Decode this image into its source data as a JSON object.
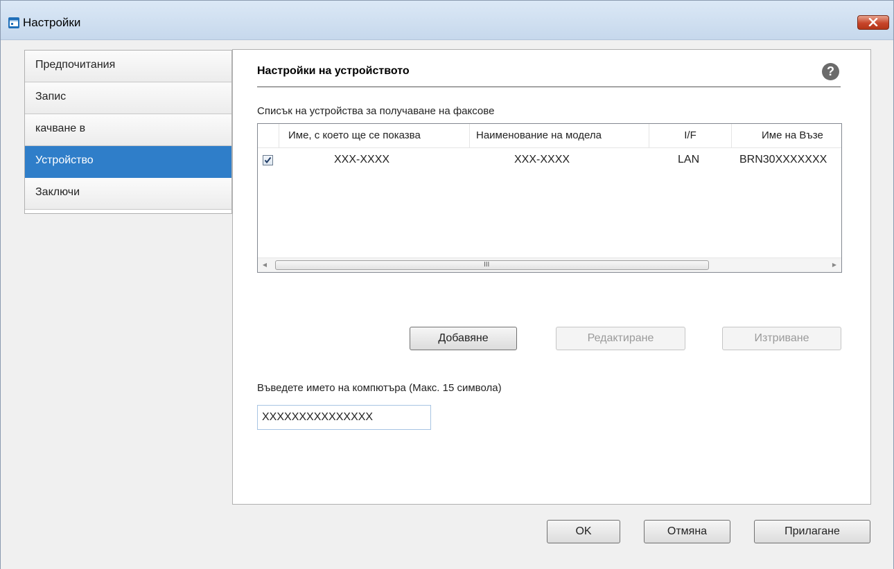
{
  "window": {
    "title": "Настройки"
  },
  "sidebar": {
    "items": [
      {
        "label": "Предпочитания",
        "selected": false
      },
      {
        "label": "Запис",
        "selected": false
      },
      {
        "label": "качване в",
        "selected": false
      },
      {
        "label": "Устройство",
        "selected": true
      },
      {
        "label": "Заключи",
        "selected": false
      }
    ]
  },
  "main": {
    "section_title": "Настройки на устройството",
    "help_icon": "?",
    "list_label": "Списък на устройства за получаване на факсове",
    "columns": [
      "Име, с което ще се показва",
      "Наименование на модела",
      "I/F",
      "Име на Възе"
    ],
    "rows": [
      {
        "checked": true,
        "display_name": "XXX-XXXX",
        "model": "XXX-XXXX",
        "if": "LAN",
        "node": "BRN30XXXXXXX"
      }
    ],
    "scroll_grip": "III",
    "buttons": {
      "add": "Добавяне",
      "edit": "Редактиране",
      "delete": "Изтриване"
    },
    "pc_name_label": "Въведете името на компютъра (Макс. 15 символа)",
    "pc_name_value": "XXXXXXXXXXXXXXX"
  },
  "footer": {
    "ok": "OK",
    "cancel": "Отмяна",
    "apply": "Прилагане"
  },
  "colors": {
    "selected_nav": "#2f7ec9",
    "close_button": "#c7452a"
  }
}
